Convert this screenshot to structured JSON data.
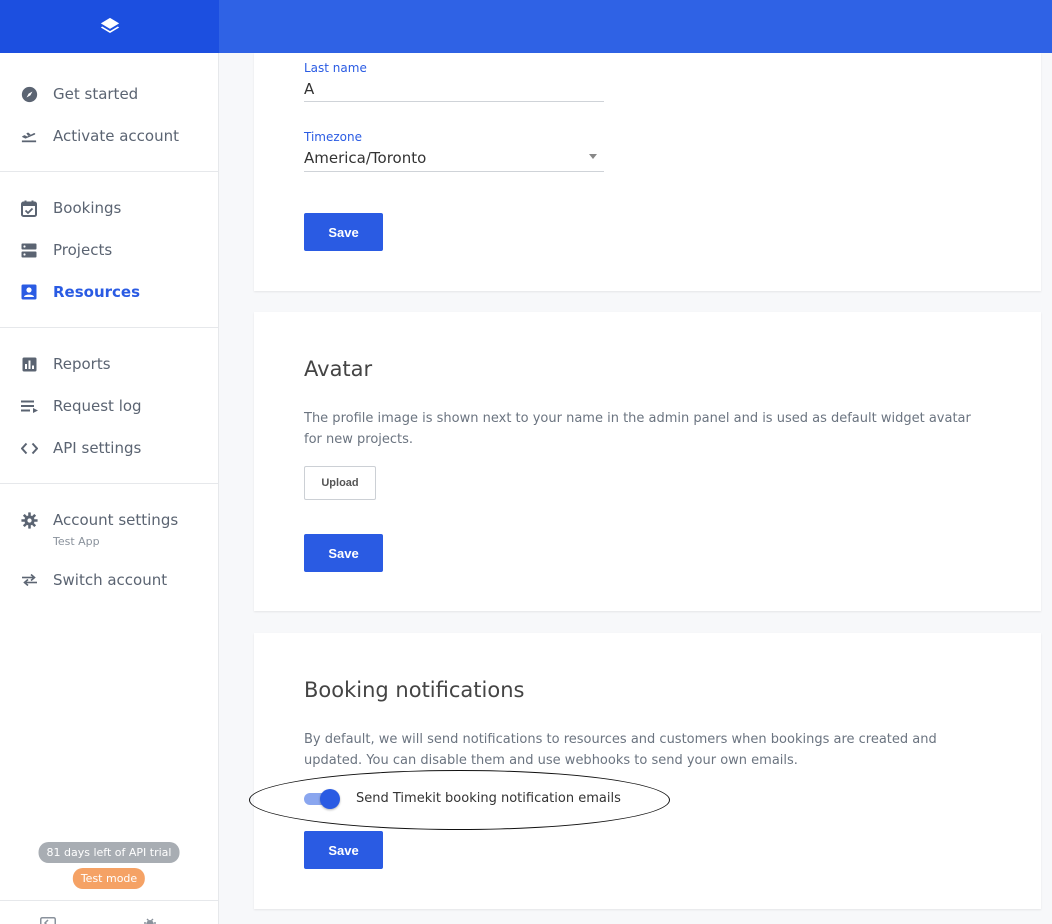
{
  "sidebar": {
    "groups": [
      [
        {
          "label": "Get started",
          "icon": "compass-icon"
        },
        {
          "label": "Activate account",
          "icon": "airplane-takeoff-icon"
        }
      ],
      [
        {
          "label": "Bookings",
          "icon": "calendar-check-icon"
        },
        {
          "label": "Projects",
          "icon": "server-icon"
        },
        {
          "label": "Resources",
          "icon": "contact-card-icon",
          "active": true
        }
      ],
      [
        {
          "label": "Reports",
          "icon": "bar-chart-icon"
        },
        {
          "label": "Request log",
          "icon": "list-arrow-icon"
        },
        {
          "label": "API settings",
          "icon": "code-brackets-icon"
        }
      ],
      [
        {
          "label": "Account settings",
          "sublabel": "Test App",
          "icon": "gear-icon"
        },
        {
          "label": "Switch account",
          "icon": "swap-arrows-icon"
        }
      ]
    ],
    "trial_badge": "81 days left of API trial",
    "mode_badge": "Test mode"
  },
  "profile_form": {
    "last_name_label": "Last name",
    "last_name_value": "A",
    "timezone_label": "Timezone",
    "timezone_value": "America/Toronto",
    "save_label": "Save"
  },
  "avatar": {
    "title": "Avatar",
    "description": "The profile image is shown next to your name in the admin panel and is used as default widget avatar for new projects.",
    "upload_label": "Upload",
    "save_label": "Save"
  },
  "notifications": {
    "title": "Booking notifications",
    "description": "By default, we will send notifications to resources and customers when bookings are created and updated. You can disable them and use webhooks to send your own emails.",
    "toggle_label": "Send Timekit booking notification emails",
    "toggle_on": true,
    "save_label": "Save"
  },
  "colors": {
    "brand_blue": "#2a5be3",
    "header_blue": "#2f62e5",
    "logo_blue": "#1c4fe0",
    "trial_gray": "#a8adb3",
    "test_orange": "#f5a265"
  }
}
